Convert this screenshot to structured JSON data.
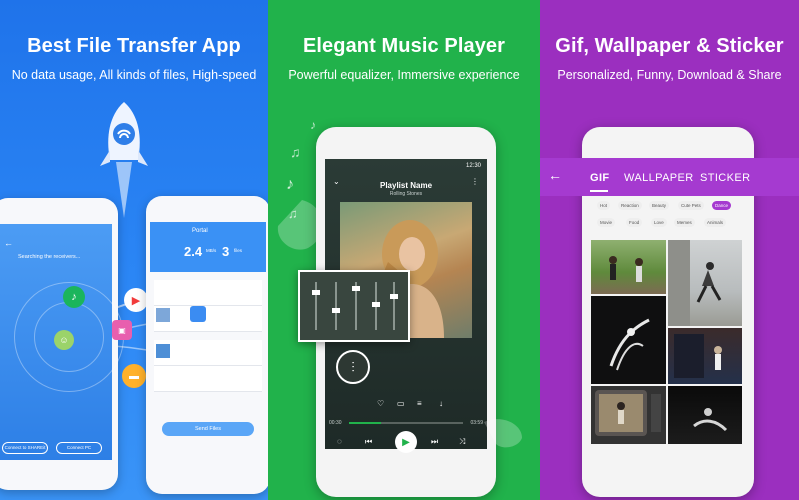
{
  "panels": [
    {
      "title": "Best File Transfer App",
      "subtitle": "No data usage, All kinds of files, High-speed",
      "left_phone": {
        "searching": "Searching the receivers...",
        "btn_connect": "Connect to SHAREit",
        "btn_connect_pc": "Connect PC"
      },
      "right_phone": {
        "header": "Portal",
        "stat_left": "2.4",
        "stat_left_unit": "MB/s",
        "stat_right": "3",
        "stat_right_unit": "files",
        "send_button": "Send Files"
      }
    },
    {
      "title": "Elegant Music Player",
      "subtitle": "Powerful equalizer, Immersive experience",
      "player": {
        "status_time": "12:30",
        "playlist_name": "Playlist Name",
        "artist": "Rolling Stones",
        "time_elapsed": "00:30",
        "time_total": "03:59"
      }
    },
    {
      "title": "Gif, Wallpaper & Sticker",
      "subtitle": "Personalized, Funny, Download & Share",
      "tabs": [
        "GIF",
        "WALLPAPER",
        "STICKER"
      ],
      "chips_row1": [
        "Hot",
        "Reaction",
        "Beauty",
        "Cute Pets",
        "Dance"
      ],
      "chips_row2": [
        "Movie",
        "Food",
        "Love",
        "Memes",
        "Animals"
      ]
    }
  ],
  "colors": {
    "panel1": "#1f73ea",
    "panel2": "#21b24b",
    "panel3": "#9b2fbf"
  }
}
